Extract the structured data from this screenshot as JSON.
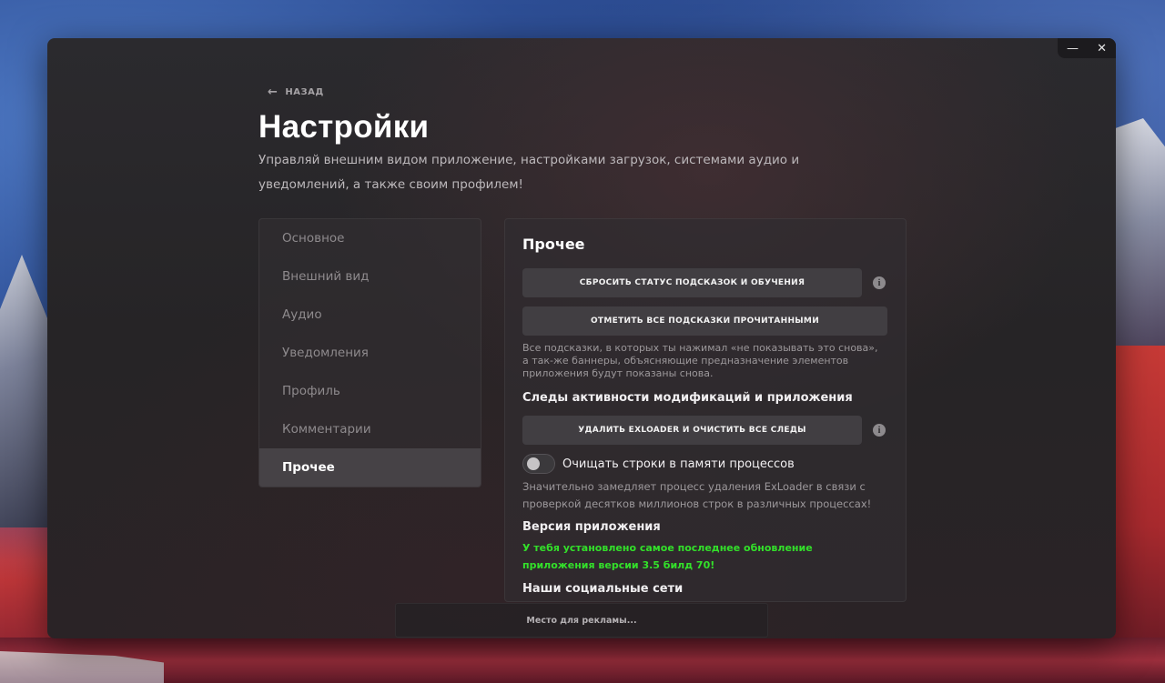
{
  "window": {
    "minimize_label": "—",
    "close_label": "✕"
  },
  "header": {
    "back_label": "НАЗАД",
    "title": "Настройки",
    "subtitle": "Управляй внешним видом приложение, настройками загрузок, системами аудио и уведомлений, а также своим профилем!"
  },
  "sidebar": {
    "items": [
      {
        "label": "Основное",
        "active": false
      },
      {
        "label": "Внешний вид",
        "active": false
      },
      {
        "label": "Аудио",
        "active": false
      },
      {
        "label": "Уведомления",
        "active": false
      },
      {
        "label": "Профиль",
        "active": false
      },
      {
        "label": "Комментарии",
        "active": false
      },
      {
        "label": "Прочее",
        "active": true
      }
    ]
  },
  "panel": {
    "title": "Прочее",
    "reset_hints_button": "СБРОСИТЬ СТАТУС ПОДСКАЗОК И ОБУЧЕНИЯ",
    "mark_read_button": "ОТМЕТИТЬ ВСЕ ПОДСКАЗКИ ПРОЧИТАННЫМИ",
    "hints_note": "Все подсказки, в которых ты нажимал «не показывать это снова», а так-же баннеры, объясняющие предназначение элементов приложения будут показаны снова.",
    "traces_heading": "Следы активности модификаций и приложения",
    "delete_button": "УДАЛИТЬ EXLOADER И ОЧИСТИТЬ ВСЕ СЛЕДЫ",
    "toggle_label": "Очищать строки в памяти процессов",
    "toggle_on": false,
    "toggle_note": "Значительно замедляет процесс удаления ExLoader в связи с проверкой десятков миллионов строк в различных процессах!",
    "version_heading": "Версия приложения",
    "version_status": "У тебя установлено самое последнее обновление приложения версии 3.5 билд 70!",
    "social_heading": "Наши социальные сети",
    "info_icon_glyph": "i"
  },
  "ad": {
    "label": "Место для рекламы..."
  },
  "colors": {
    "accent_green": "#33e02a",
    "active_item_bg": "#4a474b",
    "button_bg": "#413e42"
  }
}
